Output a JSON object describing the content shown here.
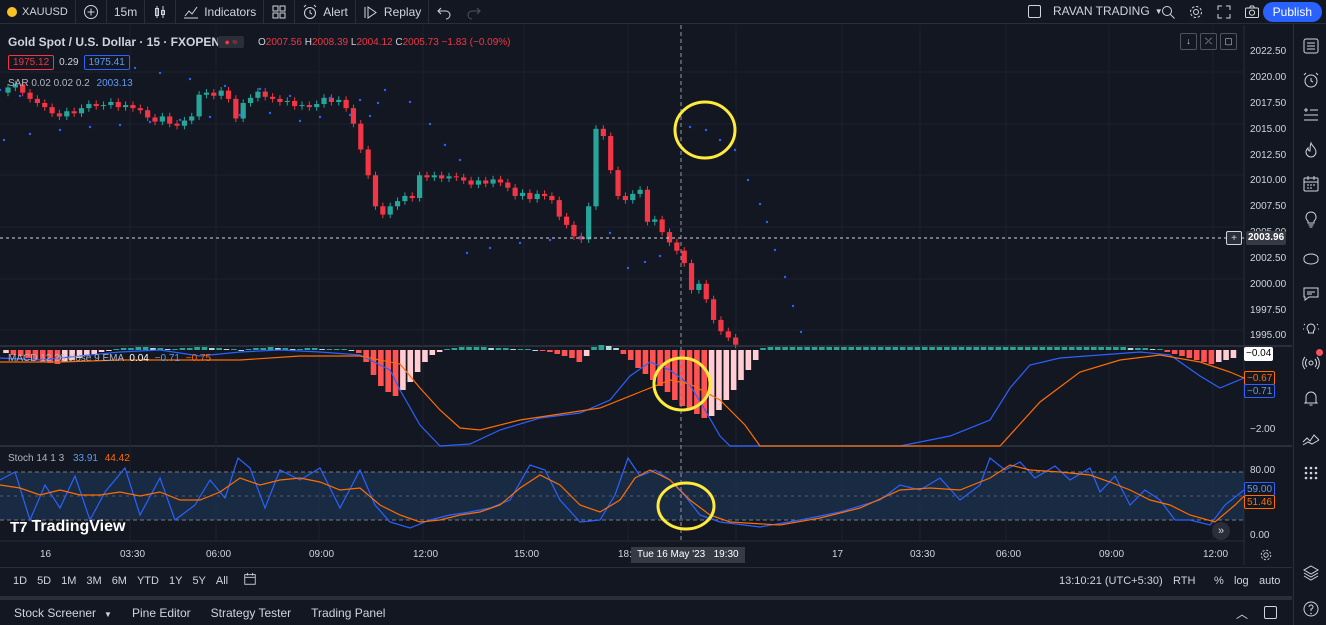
{
  "toolbar": {
    "symbol": "XAUUSD",
    "interval": "15m",
    "indicators": "Indicators",
    "alert": "Alert",
    "replay": "Replay",
    "layout_name": "RAVAN TRADING",
    "publish": "Publish"
  },
  "legend": {
    "title": "Gold Spot / U.S. Dollar · 15 · FXOPEN",
    "o_label": "O",
    "o": "2007.56",
    "h_label": "H",
    "h": "2008.39",
    "l_label": "L",
    "l": "2004.12",
    "c_label": "C",
    "c": "2005.73",
    "chg": "−1.83 (−0.09%)",
    "bid": "1975.12",
    "spread": "0.29",
    "ask": "1975.41",
    "sar_label": "SAR 0.02 0.02 0.2",
    "sar_value": "2003.13",
    "macd_label": "MACD 12 26 close 9 EMA",
    "macd_v1": "0.04",
    "macd_v2": "−0.71",
    "macd_v3": "−0.75",
    "stoch_label": "Stoch 14 1 3",
    "stoch_k": "33.91",
    "stoch_d": "44.42"
  },
  "price_axis": [
    "2022.50",
    "2020.00",
    "2017.50",
    "2015.00",
    "2012.50",
    "2010.00",
    "2007.50",
    "2005.00",
    "2002.50",
    "2000.00",
    "1997.50",
    "1995.00"
  ],
  "current_price": "2003.96",
  "macd_axis": {
    "top": "−0.04",
    "orange": "−0.67",
    "blue": "−0.71",
    "low": "−2.00"
  },
  "stoch_axis": {
    "v80": "80.00",
    "blue": "59.00",
    "orange": "51.46",
    "v0": "0.00"
  },
  "time_axis": [
    "16",
    "03:30",
    "06:00",
    "09:00",
    "12:00",
    "15:00",
    "18:",
    "00",
    "17",
    "03:30",
    "06:00",
    "09:00",
    "12:00"
  ],
  "crosshair_time": "Tue 16 May '23   19:30",
  "watermark": "TradingView",
  "ranges": [
    "1D",
    "5D",
    "1M",
    "3M",
    "6M",
    "YTD",
    "1Y",
    "5Y",
    "All"
  ],
  "clock": "13:10:21 (UTC+5:30)",
  "session": "RTH",
  "scale": {
    "pct": "%",
    "log": "log",
    "auto": "auto"
  },
  "bottom_tabs": [
    "Stock Screener",
    "Pine Editor",
    "Strategy Tester",
    "Trading Panel"
  ],
  "colors": {
    "up": "#26a69a",
    "down": "#f23645",
    "bg": "#131722",
    "accent": "#2962ff",
    "highlight": "#ffeb3b"
  }
}
